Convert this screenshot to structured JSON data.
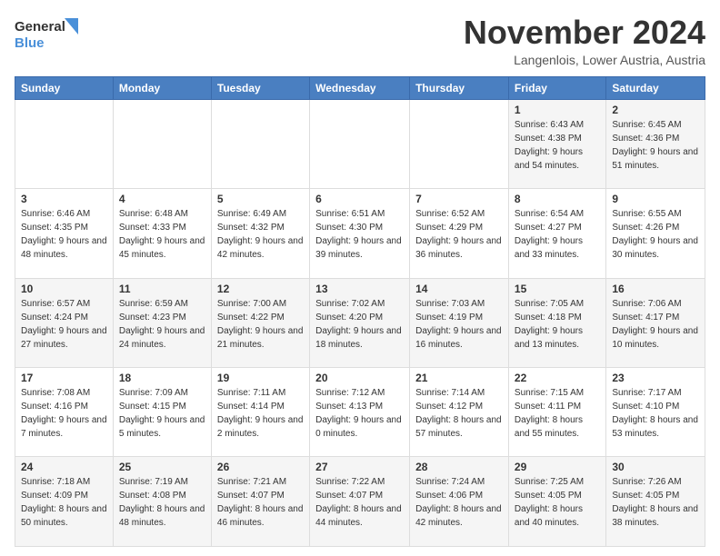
{
  "logo": {
    "line1": "General",
    "line2": "Blue"
  },
  "header": {
    "month": "November 2024",
    "location": "Langenlois, Lower Austria, Austria"
  },
  "weekdays": [
    "Sunday",
    "Monday",
    "Tuesday",
    "Wednesday",
    "Thursday",
    "Friday",
    "Saturday"
  ],
  "weeks": [
    [
      {
        "day": "",
        "sunrise": "",
        "sunset": "",
        "daylight": ""
      },
      {
        "day": "",
        "sunrise": "",
        "sunset": "",
        "daylight": ""
      },
      {
        "day": "",
        "sunrise": "",
        "sunset": "",
        "daylight": ""
      },
      {
        "day": "",
        "sunrise": "",
        "sunset": "",
        "daylight": ""
      },
      {
        "day": "",
        "sunrise": "",
        "sunset": "",
        "daylight": ""
      },
      {
        "day": "1",
        "sunrise": "Sunrise: 6:43 AM",
        "sunset": "Sunset: 4:38 PM",
        "daylight": "Daylight: 9 hours and 54 minutes."
      },
      {
        "day": "2",
        "sunrise": "Sunrise: 6:45 AM",
        "sunset": "Sunset: 4:36 PM",
        "daylight": "Daylight: 9 hours and 51 minutes."
      }
    ],
    [
      {
        "day": "3",
        "sunrise": "Sunrise: 6:46 AM",
        "sunset": "Sunset: 4:35 PM",
        "daylight": "Daylight: 9 hours and 48 minutes."
      },
      {
        "day": "4",
        "sunrise": "Sunrise: 6:48 AM",
        "sunset": "Sunset: 4:33 PM",
        "daylight": "Daylight: 9 hours and 45 minutes."
      },
      {
        "day": "5",
        "sunrise": "Sunrise: 6:49 AM",
        "sunset": "Sunset: 4:32 PM",
        "daylight": "Daylight: 9 hours and 42 minutes."
      },
      {
        "day": "6",
        "sunrise": "Sunrise: 6:51 AM",
        "sunset": "Sunset: 4:30 PM",
        "daylight": "Daylight: 9 hours and 39 minutes."
      },
      {
        "day": "7",
        "sunrise": "Sunrise: 6:52 AM",
        "sunset": "Sunset: 4:29 PM",
        "daylight": "Daylight: 9 hours and 36 minutes."
      },
      {
        "day": "8",
        "sunrise": "Sunrise: 6:54 AM",
        "sunset": "Sunset: 4:27 PM",
        "daylight": "Daylight: 9 hours and 33 minutes."
      },
      {
        "day": "9",
        "sunrise": "Sunrise: 6:55 AM",
        "sunset": "Sunset: 4:26 PM",
        "daylight": "Daylight: 9 hours and 30 minutes."
      }
    ],
    [
      {
        "day": "10",
        "sunrise": "Sunrise: 6:57 AM",
        "sunset": "Sunset: 4:24 PM",
        "daylight": "Daylight: 9 hours and 27 minutes."
      },
      {
        "day": "11",
        "sunrise": "Sunrise: 6:59 AM",
        "sunset": "Sunset: 4:23 PM",
        "daylight": "Daylight: 9 hours and 24 minutes."
      },
      {
        "day": "12",
        "sunrise": "Sunrise: 7:00 AM",
        "sunset": "Sunset: 4:22 PM",
        "daylight": "Daylight: 9 hours and 21 minutes."
      },
      {
        "day": "13",
        "sunrise": "Sunrise: 7:02 AM",
        "sunset": "Sunset: 4:20 PM",
        "daylight": "Daylight: 9 hours and 18 minutes."
      },
      {
        "day": "14",
        "sunrise": "Sunrise: 7:03 AM",
        "sunset": "Sunset: 4:19 PM",
        "daylight": "Daylight: 9 hours and 16 minutes."
      },
      {
        "day": "15",
        "sunrise": "Sunrise: 7:05 AM",
        "sunset": "Sunset: 4:18 PM",
        "daylight": "Daylight: 9 hours and 13 minutes."
      },
      {
        "day": "16",
        "sunrise": "Sunrise: 7:06 AM",
        "sunset": "Sunset: 4:17 PM",
        "daylight": "Daylight: 9 hours and 10 minutes."
      }
    ],
    [
      {
        "day": "17",
        "sunrise": "Sunrise: 7:08 AM",
        "sunset": "Sunset: 4:16 PM",
        "daylight": "Daylight: 9 hours and 7 minutes."
      },
      {
        "day": "18",
        "sunrise": "Sunrise: 7:09 AM",
        "sunset": "Sunset: 4:15 PM",
        "daylight": "Daylight: 9 hours and 5 minutes."
      },
      {
        "day": "19",
        "sunrise": "Sunrise: 7:11 AM",
        "sunset": "Sunset: 4:14 PM",
        "daylight": "Daylight: 9 hours and 2 minutes."
      },
      {
        "day": "20",
        "sunrise": "Sunrise: 7:12 AM",
        "sunset": "Sunset: 4:13 PM",
        "daylight": "Daylight: 9 hours and 0 minutes."
      },
      {
        "day": "21",
        "sunrise": "Sunrise: 7:14 AM",
        "sunset": "Sunset: 4:12 PM",
        "daylight": "Daylight: 8 hours and 57 minutes."
      },
      {
        "day": "22",
        "sunrise": "Sunrise: 7:15 AM",
        "sunset": "Sunset: 4:11 PM",
        "daylight": "Daylight: 8 hours and 55 minutes."
      },
      {
        "day": "23",
        "sunrise": "Sunrise: 7:17 AM",
        "sunset": "Sunset: 4:10 PM",
        "daylight": "Daylight: 8 hours and 53 minutes."
      }
    ],
    [
      {
        "day": "24",
        "sunrise": "Sunrise: 7:18 AM",
        "sunset": "Sunset: 4:09 PM",
        "daylight": "Daylight: 8 hours and 50 minutes."
      },
      {
        "day": "25",
        "sunrise": "Sunrise: 7:19 AM",
        "sunset": "Sunset: 4:08 PM",
        "daylight": "Daylight: 8 hours and 48 minutes."
      },
      {
        "day": "26",
        "sunrise": "Sunrise: 7:21 AM",
        "sunset": "Sunset: 4:07 PM",
        "daylight": "Daylight: 8 hours and 46 minutes."
      },
      {
        "day": "27",
        "sunrise": "Sunrise: 7:22 AM",
        "sunset": "Sunset: 4:07 PM",
        "daylight": "Daylight: 8 hours and 44 minutes."
      },
      {
        "day": "28",
        "sunrise": "Sunrise: 7:24 AM",
        "sunset": "Sunset: 4:06 PM",
        "daylight": "Daylight: 8 hours and 42 minutes."
      },
      {
        "day": "29",
        "sunrise": "Sunrise: 7:25 AM",
        "sunset": "Sunset: 4:05 PM",
        "daylight": "Daylight: 8 hours and 40 minutes."
      },
      {
        "day": "30",
        "sunrise": "Sunrise: 7:26 AM",
        "sunset": "Sunset: 4:05 PM",
        "daylight": "Daylight: 8 hours and 38 minutes."
      }
    ]
  ]
}
